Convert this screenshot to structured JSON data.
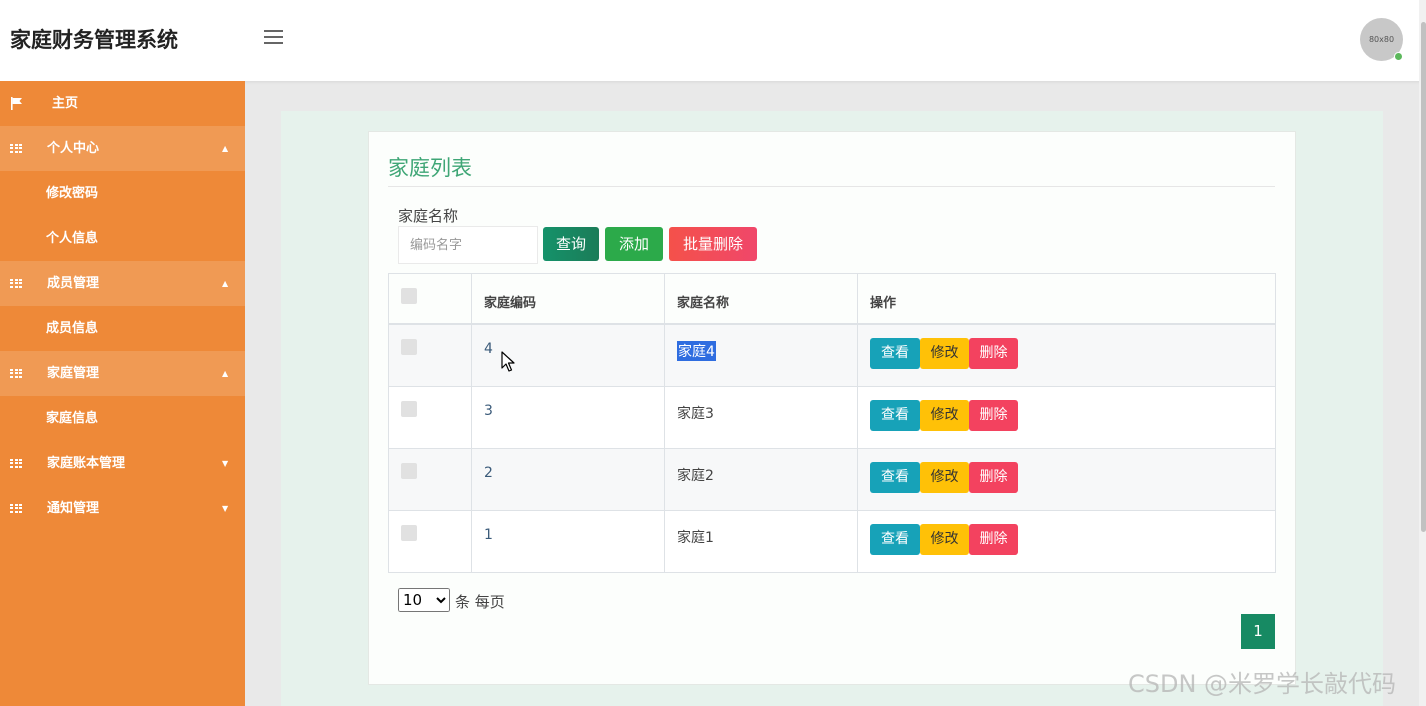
{
  "header": {
    "title": "家庭财务管理系统",
    "avatar_text": "80x80"
  },
  "sidebar": {
    "items": [
      {
        "label": "主页",
        "icon": "flag-icon"
      },
      {
        "label": "个人中心",
        "icon": "grid-icon",
        "expanded": true
      },
      {
        "label": "修改密码"
      },
      {
        "label": "个人信息"
      },
      {
        "label": "成员管理",
        "icon": "grid-icon",
        "expanded": true
      },
      {
        "label": "成员信息"
      },
      {
        "label": "家庭管理",
        "icon": "grid-icon",
        "expanded": true
      },
      {
        "label": "家庭信息"
      },
      {
        "label": "家庭账本管理",
        "icon": "grid-icon",
        "expanded": false
      },
      {
        "label": "通知管理",
        "icon": "grid-icon",
        "expanded": false
      }
    ],
    "caret_up": "▲",
    "caret_down": "▼"
  },
  "panel": {
    "title": "家庭列表",
    "search_label": "家庭名称",
    "search_placeholder": "编码名字",
    "query_label": "查询",
    "add_label": "添加",
    "batch_delete_label": "批量删除"
  },
  "table": {
    "headers": [
      "家庭编码",
      "家庭名称",
      "操作"
    ],
    "rows": [
      {
        "code": "4",
        "name": "家庭4",
        "selected_text": true
      },
      {
        "code": "3",
        "name": "家庭3"
      },
      {
        "code": "2",
        "name": "家庭2"
      },
      {
        "code": "1",
        "name": "家庭1"
      }
    ],
    "actions": {
      "view": "查看",
      "edit": "修改",
      "delete": "删除"
    }
  },
  "pagination": {
    "page_size": "10",
    "page_size_options": [
      "10"
    ],
    "page_size_suffix": "条 每页",
    "current_page": "1"
  },
  "watermark": "CSDN @米罗学长敲代码",
  "colors": {
    "sidebar": "#ee8938",
    "accent_green": "#3fa676",
    "view": "#17a2b8",
    "edit": "#ffc107",
    "delete": "#f3425f"
  }
}
